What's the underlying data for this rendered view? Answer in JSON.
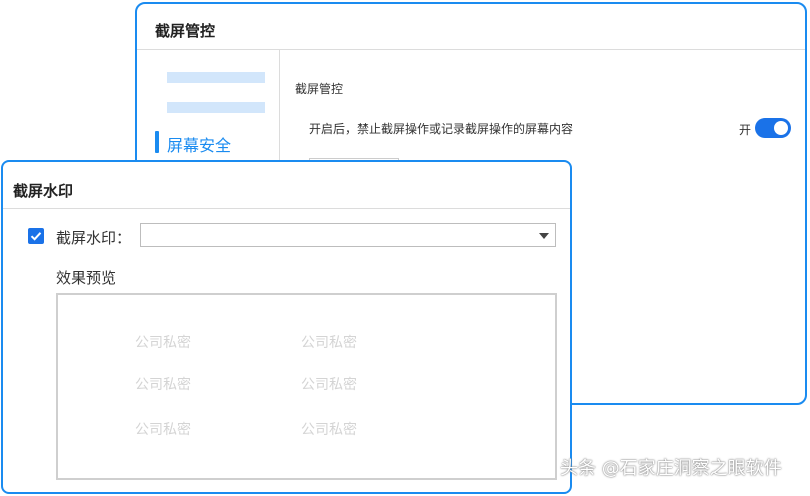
{
  "back_window": {
    "title": "截屏管控",
    "sidebar": {
      "active_label": "屏幕安全"
    },
    "section_label": "截屏管控",
    "description": "开启后，禁止截屏操作或记录截屏操作的屏幕内容",
    "toggle": {
      "state_label": "开",
      "on": true
    }
  },
  "front_window": {
    "title": "截屏水印",
    "checkbox": {
      "checked": true
    },
    "field_label": "截屏水印：",
    "select_value": "",
    "preview_label": "效果预览",
    "preview_watermarks": [
      "公司私密",
      "公司私密",
      "公司私密",
      "公司私密",
      "公司私密",
      "公司私密"
    ]
  },
  "page_watermark": "头条 @石家庄洞察之眼软件",
  "colors": {
    "accent": "#1a8bf0",
    "toggle_on": "#1a72e8",
    "placeholder": "#d2e6fb",
    "watermark_text": "#d4d4d4"
  }
}
